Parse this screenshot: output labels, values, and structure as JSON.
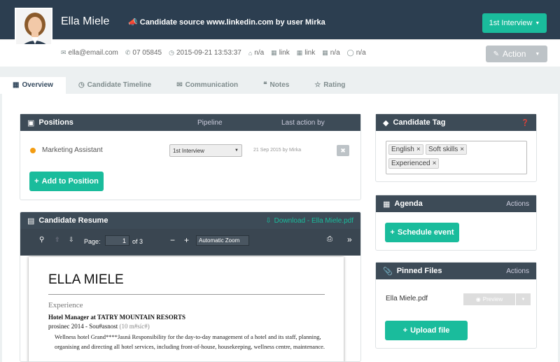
{
  "header": {
    "name": "Ella Miele",
    "source_prefix": "Candidate source",
    "source_site": "www.linkedin.com",
    "source_mid": "by user",
    "source_user": "Mirka",
    "status_button": "1st Interview",
    "action_button": "Action"
  },
  "contacts": {
    "email": "ella@email.com",
    "phone": "07 05845",
    "datetime": "2015-09-21 13:53:37",
    "home": "n/a",
    "linkedin": "link",
    "twitter": "link",
    "facebook": "n/a",
    "skype": "n/a"
  },
  "tabs": [
    {
      "label": "Overview",
      "icon": "grid-icon"
    },
    {
      "label": "Candidate Timeline",
      "icon": "clock-icon"
    },
    {
      "label": "Communication",
      "icon": "envelope-icon"
    },
    {
      "label": "Notes",
      "icon": "quote-icon"
    },
    {
      "label": "Rating",
      "icon": "star-icon"
    }
  ],
  "positions": {
    "title": "Positions",
    "col_pipeline": "Pipeline",
    "col_last": "Last action by",
    "row_name": "Marketing Assistant",
    "row_stage": "1st Interview",
    "row_last": "21 Sep 2015 by Mirka",
    "add_button": "Add to Position"
  },
  "resume": {
    "title": "Candidate Resume",
    "download": "Download - Ella Miele.pdf",
    "page_label": "Page:",
    "page_num": "1",
    "page_of": "of 3",
    "zoom": "Automatic Zoom",
    "doc_name": "ELLA MIELE",
    "doc_section": "Experience",
    "doc_job": "Hotel Manager  at  TATRY MOUNTAIN RESORTS",
    "doc_date": "prosinec 2014  -  Sou#asnost",
    "doc_duration": "(10 m#síc#)",
    "doc_body": "Wellness hotel Grand****Jasná Responsibility for the day-to-day management of a hotel and its staff, planning, organising and directing all hotel services, including front-of-house, housekeeping, wellness centre, maintenance."
  },
  "tagpanel": {
    "title": "Candidate Tag",
    "tags": [
      "English",
      "Soft skills",
      "Experienced"
    ]
  },
  "agenda": {
    "title": "Agenda",
    "actions": "Actions",
    "button": "Schedule event"
  },
  "pinned": {
    "title": "Pinned Files",
    "actions": "Actions",
    "file": "Ella Miele.pdf",
    "preview": "Preview",
    "upload": "Upload file"
  },
  "colors": {
    "accent": "#1abc9c",
    "header": "#2c3e50",
    "panel_head": "#3d4b57",
    "status_dot": "#f39c12"
  }
}
